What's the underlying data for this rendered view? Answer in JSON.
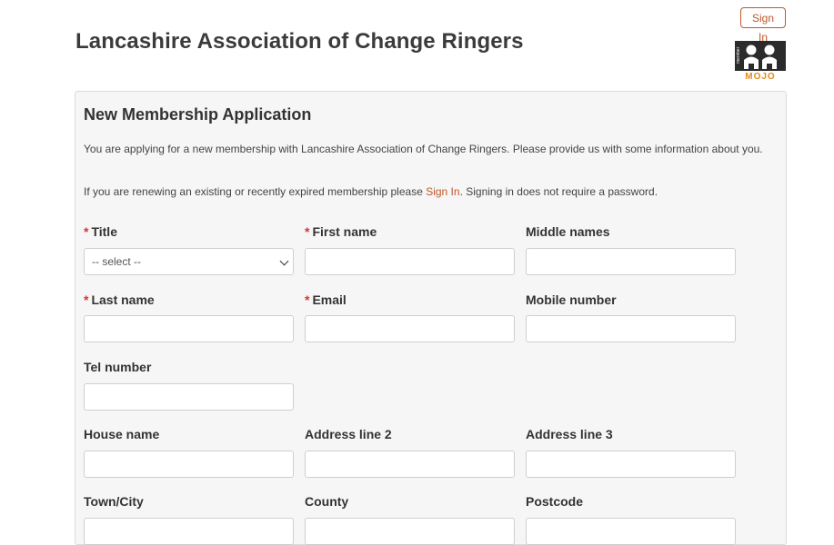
{
  "header": {
    "sign_in_button": "Sign In",
    "org_title": "Lancashire Association of Change Ringers",
    "logo": {
      "top_text": "member",
      "bottom_text": "MOJO",
      "icon": "members-logo-icon"
    }
  },
  "form": {
    "title": "New Membership Application",
    "intro": "You are applying for a new membership with Lancashire Association of Change Ringers. Please provide us with some information about you.",
    "renew_prefix": "If you are renewing an existing or recently expired membership please ",
    "renew_link": "Sign In",
    "renew_suffix": ". Signing in does not require a password.",
    "required_marker": "*",
    "fields": {
      "title": {
        "label": "Title",
        "value": "-- select --"
      },
      "first_name": {
        "label": "First name",
        "value": ""
      },
      "middle_names": {
        "label": "Middle names",
        "value": ""
      },
      "last_name": {
        "label": "Last name",
        "value": ""
      },
      "email": {
        "label": "Email",
        "value": ""
      },
      "mobile": {
        "label": "Mobile number",
        "value": ""
      },
      "tel": {
        "label": "Tel number",
        "value": ""
      },
      "house_name": {
        "label": "House name",
        "value": ""
      },
      "address2": {
        "label": "Address line 2",
        "value": ""
      },
      "address3": {
        "label": "Address line 3",
        "value": ""
      },
      "town": {
        "label": "Town/City",
        "value": ""
      },
      "county": {
        "label": "County",
        "value": ""
      },
      "postcode": {
        "label": "Postcode",
        "value": ""
      }
    }
  },
  "colors": {
    "accent": "#c0572a",
    "required": "#d9342b",
    "logo_orange": "#e8891c"
  }
}
